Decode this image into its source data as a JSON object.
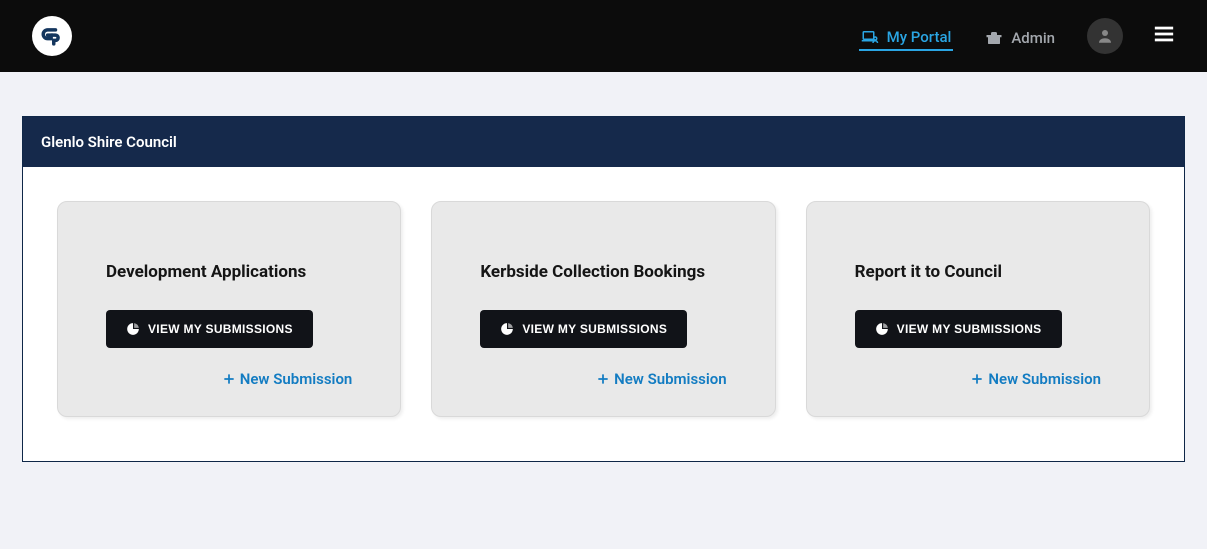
{
  "nav": {
    "portal": "My Portal",
    "admin": "Admin"
  },
  "panel": {
    "title": "Glenlo Shire Council"
  },
  "cards": [
    {
      "title": "Development Applications",
      "view": "VIEW MY SUBMISSIONS",
      "new": "New Submission"
    },
    {
      "title": "Kerbside Collection Bookings",
      "view": "VIEW MY SUBMISSIONS",
      "new": "New Submission"
    },
    {
      "title": "Report it to Council",
      "view": "VIEW MY SUBMISSIONS",
      "new": "New Submission"
    }
  ]
}
